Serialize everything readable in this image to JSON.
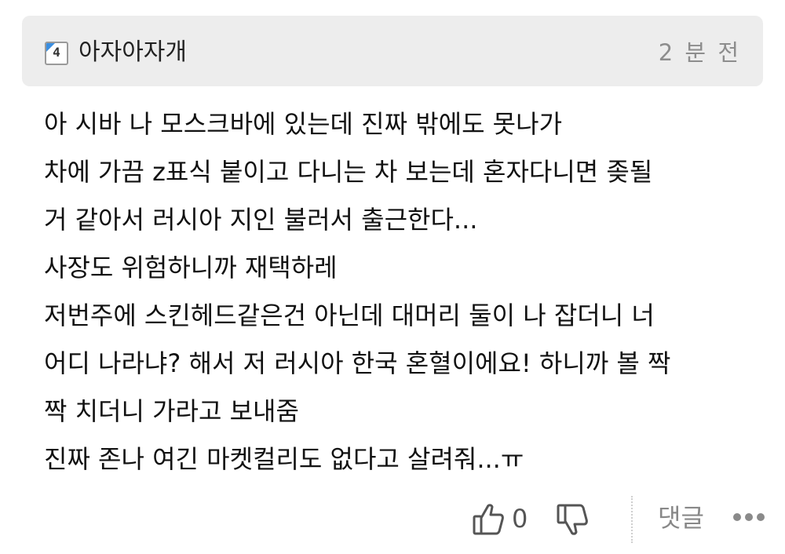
{
  "comment": {
    "author": {
      "level_badge": "4",
      "name": "아자아자개"
    },
    "time": "2 분 전",
    "lines": [
      "아 시바 나 모스크바에 있는데 진짜 밖에도 못나가",
      "차에 가끔 z표식 붙이고 다니는 차 보는데 혼자다니면 좆될",
      "거 같아서 러시아 지인 불러서 출근한다...",
      "사장도 위험하니까 재택하레",
      "저번주에 스킨헤드같은건 아닌데 대머리 둘이 나 잡더니 너",
      "어디 나라냐? 해서 저 러시아 한국 혼혈이에요! 하니까 볼 짝",
      "짝 치더니 가라고 보내줌",
      "진짜 존나 여긴 마켓컬리도 없다고 살려줘...ㅠ"
    ],
    "actions": {
      "like_icon": "thumbs-up-icon",
      "like_count": "0",
      "dislike_icon": "thumbs-down-icon",
      "reply_label": "댓글",
      "more_icon": "more-dots-icon"
    },
    "colors": {
      "header_bg": "#ededed",
      "badge_accent": "#3a8ee0",
      "muted_text": "#8d8d8d"
    }
  }
}
